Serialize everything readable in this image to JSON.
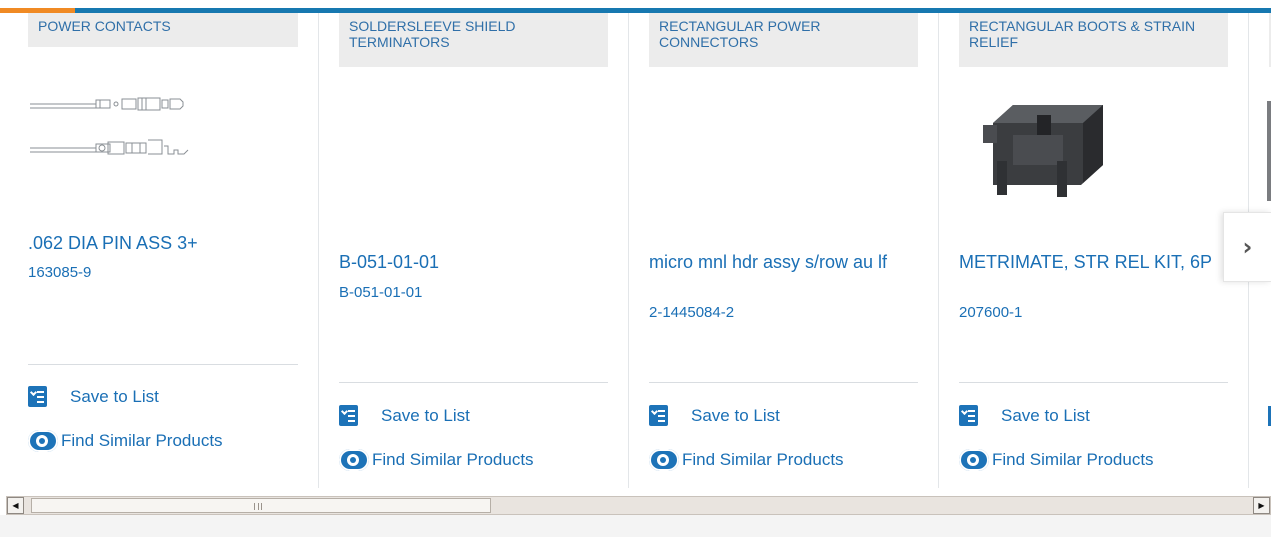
{
  "products": [
    {
      "category": "POWER CONTACTS",
      "title": ".062 DIA PIN ASS 3+",
      "part_number": "163085-9",
      "image_icon": "pin-contact-drawing",
      "save_label": "Save to List",
      "similar_label": "Find Similar Products"
    },
    {
      "category": "SOLDERSLEEVE SHIELD TERMINATORS",
      "title": "B-051-01-01",
      "part_number": "B-051-01-01",
      "image_icon": "",
      "save_label": "Save to List",
      "similar_label": "Find Similar Products"
    },
    {
      "category": "RECTANGULAR POWER CONNECTORS",
      "title": "micro mnl hdr assy s/row au lf",
      "part_number": "2-1445084-2",
      "image_icon": "",
      "save_label": "Save to List",
      "similar_label": "Find Similar Products"
    },
    {
      "category": "RECTANGULAR BOOTS & STRAIN RELIEF",
      "title": "METRIMATE, STR REL KIT, 6P",
      "part_number": "207600-1",
      "image_icon": "strain-relief-kit-photo",
      "save_label": "Save to List",
      "similar_label": "Find Similar Products"
    }
  ],
  "carousel": {
    "next_icon": "chevron-right-icon",
    "next_glyph": "›"
  },
  "scrollbar": {
    "left_glyph": "◀",
    "right_glyph": "▶"
  },
  "colors": {
    "accent": "#f08a24",
    "brand": "#1778b0",
    "link": "#1a6fb5",
    "label_bg": "#ececec"
  }
}
